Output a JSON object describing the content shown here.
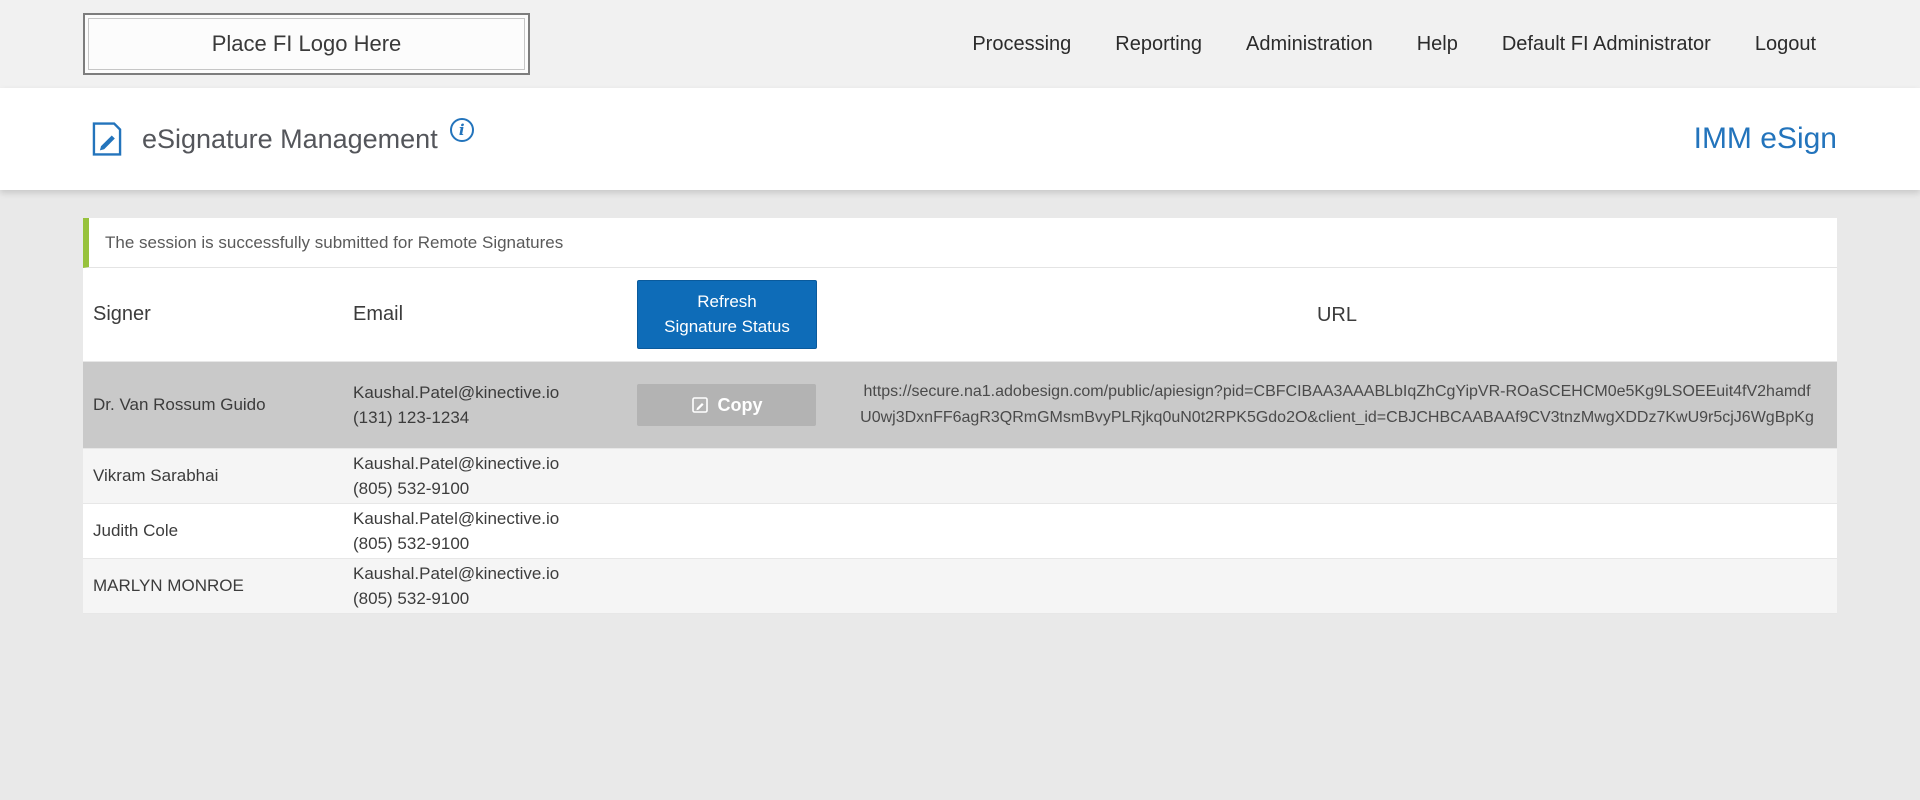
{
  "header": {
    "logo_text": "Place FI Logo Here",
    "nav": [
      {
        "label": "Processing"
      },
      {
        "label": "Reporting"
      },
      {
        "label": "Administration"
      },
      {
        "label": "Help"
      },
      {
        "label": "Default FI Administrator"
      },
      {
        "label": "Logout"
      }
    ]
  },
  "page": {
    "title": "eSignature Management",
    "brand": "IMM eSign"
  },
  "alert": {
    "message": "The session is successfully submitted for Remote Signatures"
  },
  "table": {
    "columns": {
      "signer": "Signer",
      "email": "Email",
      "url": "URL"
    },
    "refresh_button_label": "Refresh\nSignature Status",
    "copy_button_label": "Copy",
    "rows": [
      {
        "signer": "Dr. Van Rossum Guido",
        "email": "Kaushal.Patel@kinective.io",
        "phone": "(131) 123-1234",
        "url": "https://secure.na1.adobesign.com/public/apiesign?pid=CBFCIBAA3AAABLbIqZhCgYipVR-ROaSCEHCM0e5Kg9LSOEEuit4fV2hamdfU0wj3DxnFF6agR3QRmGMsmBvyPLRjkq0uN0t2RPK5Gdo2O&client_id=CBJCHBCAABAAf9CV3tnzMwgXDDz7KwU9r5cjJ6WgBpKg"
      },
      {
        "signer": "Vikram Sarabhai",
        "email": "Kaushal.Patel@kinective.io",
        "phone": "(805) 532-9100",
        "url": ""
      },
      {
        "signer": "Judith Cole",
        "email": "Kaushal.Patel@kinective.io",
        "phone": "(805) 532-9100",
        "url": ""
      },
      {
        "signer": "MARLYN MONROE",
        "email": "Kaushal.Patel@kinective.io",
        "phone": "(805) 532-9100",
        "url": ""
      }
    ]
  },
  "colors": {
    "accent_blue": "#2374bc",
    "button_blue": "#0e6cb8",
    "alert_green": "#97c23c",
    "selected_row": "#c9c9c9",
    "copy_gray": "#b3b3b3"
  }
}
